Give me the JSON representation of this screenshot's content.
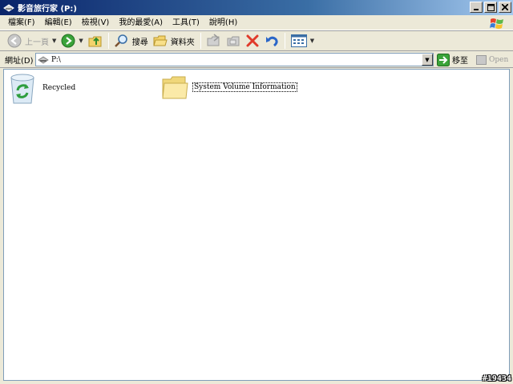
{
  "window": {
    "title": "影音旅行家 (P:)",
    "buttons": {
      "minimize": "_",
      "maximize": "□",
      "close": "X"
    }
  },
  "menu": {
    "items": [
      {
        "label": "檔案(F)"
      },
      {
        "label": "編輯(E)"
      },
      {
        "label": "檢視(V)"
      },
      {
        "label": "我的最愛(A)"
      },
      {
        "label": "工具(T)"
      },
      {
        "label": "說明(H)"
      }
    ]
  },
  "toolbar": {
    "back_label": "上一頁",
    "search_label": "搜尋",
    "folders_label": "資料夾"
  },
  "address": {
    "label": "網址(D)",
    "value": "P:\\",
    "go_label": "移至",
    "open_label": "Open"
  },
  "files": [
    {
      "name": "Recycled",
      "icon": "recycle-bin-icon"
    },
    {
      "name": "System Volume Information",
      "icon": "folder-icon",
      "selected": true
    }
  ],
  "watermark": "#19434",
  "colors": {
    "titlebar_start": "#0A246A",
    "titlebar_end": "#A6CAF0",
    "chrome": "#ECE9D8",
    "delete_red": "#E03A2A",
    "go_green": "#3AA33A"
  }
}
